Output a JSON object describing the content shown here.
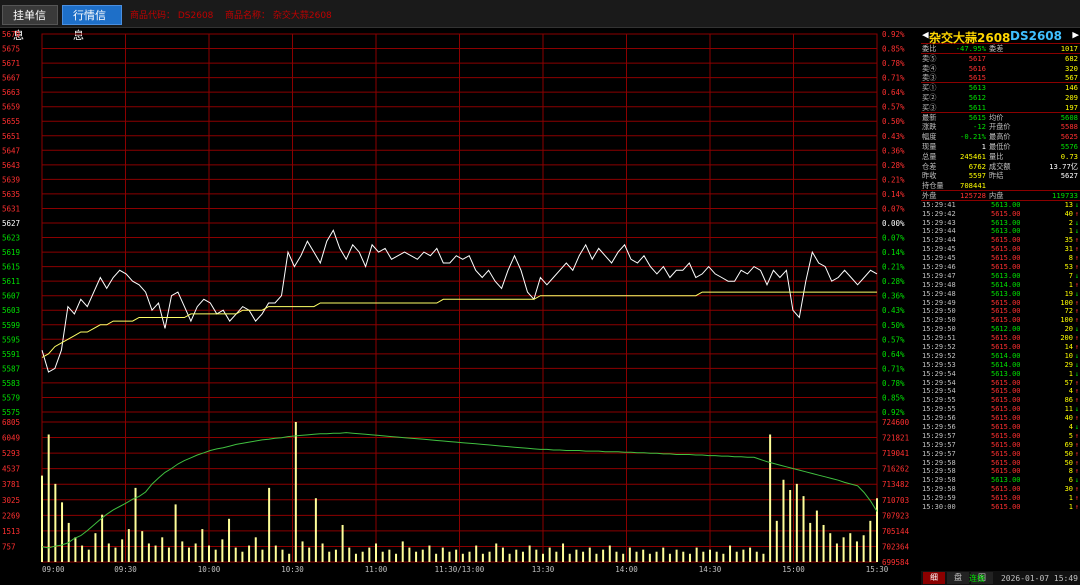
{
  "tabs": [
    {
      "label": "挂单信息",
      "active": false
    },
    {
      "label": "行情信息",
      "active": true
    }
  ],
  "top_info": {
    "code": "商品代码： DS2608",
    "name": "商品名称： 杂交大蒜2608"
  },
  "chart_data": [
    {
      "type": "line",
      "name": "price",
      "y_left_ticks": [
        "5679",
        "5675",
        "5671",
        "5667",
        "5663",
        "5659",
        "5655",
        "5651",
        "5647",
        "5643",
        "5639",
        "5635",
        "5631",
        "5627",
        "5623",
        "5619",
        "5615",
        "5611",
        "5607",
        "5603",
        "5599",
        "5595",
        "5591",
        "5587",
        "5583",
        "5579",
        "5575"
      ],
      "y_right_ticks": [
        "0.92%",
        "0.85%",
        "0.78%",
        "0.71%",
        "0.64%",
        "0.57%",
        "0.50%",
        "0.43%",
        "0.36%",
        "0.28%",
        "0.21%",
        "0.14%",
        "0.07%",
        "0.00%",
        "0.07%",
        "0.14%",
        "0.21%",
        "0.28%",
        "0.36%",
        "0.43%",
        "0.50%",
        "0.57%",
        "0.64%",
        "0.71%",
        "0.78%",
        "0.85%",
        "0.92%"
      ],
      "ylim": [
        5575,
        5679
      ],
      "reference": 5627,
      "x_ticks": [
        "09:00",
        "09:30",
        "10:00",
        "10:30",
        "11:00",
        "11:30/13:00",
        "13:30",
        "14:00",
        "14:30",
        "15:00",
        "15:30"
      ],
      "series": [
        {
          "color": "#ffffff",
          "values": [
            5592,
            5586,
            5587,
            5592,
            5604,
            5602,
            5606,
            5604,
            5608,
            5612,
            5609,
            5612,
            5614,
            5613,
            5611,
            5610,
            5608,
            5603,
            5605,
            5598,
            5607,
            5608,
            5604,
            5600,
            5604,
            5606,
            5605,
            5602,
            5603,
            5600,
            5602,
            5604,
            5603,
            5600,
            5602,
            5605,
            5605,
            5607,
            5619,
            5615,
            5618,
            5622,
            5619,
            5616,
            5622,
            5625,
            5620,
            5617,
            5621,
            5619,
            5615,
            5621,
            5619,
            5620,
            5617,
            5618,
            5619,
            5618,
            5617,
            5619,
            5618,
            5620,
            5616,
            5616,
            5618,
            5617,
            5618,
            5614,
            5612,
            5614,
            5611,
            5609,
            5614,
            5618,
            5614,
            5608,
            5606,
            5612,
            5610,
            5612,
            5614,
            5616,
            5614,
            5618,
            5621,
            5617,
            5620,
            5618,
            5616,
            5619,
            5621,
            5617,
            5616,
            5618,
            5615,
            5613,
            5615,
            5612,
            5614,
            5614,
            5616,
            5612,
            5613,
            5615,
            5613,
            5612,
            5611,
            5611,
            5614,
            5613,
            5615,
            5614,
            5610,
            5614,
            5612,
            5614,
            5603,
            5601,
            5611,
            5619,
            5616,
            5615,
            5611,
            5612,
            5614,
            5612,
            5610,
            5612,
            5614,
            5613
          ]
        },
        {
          "color": "#ffff66",
          "values": [
            5590,
            5591,
            5593,
            5594,
            5595,
            5596,
            5597,
            5597,
            5598,
            5599,
            5599,
            5600,
            5600,
            5600,
            5600,
            5601,
            5601,
            5601,
            5601,
            5601,
            5601,
            5601,
            5601,
            5602,
            5602,
            5602,
            5602,
            5602,
            5602,
            5602,
            5602,
            5603,
            5603,
            5603,
            5603,
            5604,
            5604,
            5604,
            5604,
            5604,
            5604,
            5604,
            5604,
            5605,
            5605,
            5605,
            5605,
            5605,
            5605,
            5605,
            5605,
            5605,
            5605,
            5605,
            5605,
            5605,
            5605,
            5605,
            5605,
            5605,
            5605,
            5605,
            5606,
            5606,
            5606,
            5606,
            5606,
            5606,
            5606,
            5606,
            5606,
            5606,
            5606,
            5606,
            5606,
            5606,
            5606,
            5607,
            5607,
            5607,
            5607,
            5607,
            5607,
            5607,
            5607,
            5607,
            5607,
            5607,
            5607,
            5607,
            5607,
            5607,
            5607,
            5607,
            5607,
            5607,
            5607,
            5607,
            5607,
            5607,
            5607,
            5607,
            5608,
            5608,
            5608,
            5608,
            5608,
            5608,
            5608,
            5608,
            5608,
            5608,
            5608,
            5608,
            5608,
            5608,
            5608,
            5608,
            5608,
            5608,
            5608,
            5608,
            5608,
            5608,
            5608,
            5608,
            5608,
            5608,
            5608,
            5608
          ]
        }
      ]
    },
    {
      "type": "bar",
      "name": "volume",
      "y_left_ticks": [
        "6805",
        "6049",
        "5293",
        "4537",
        "3781",
        "3025",
        "2269",
        "1513",
        "757"
      ],
      "y_right_ticks": [
        "724600",
        "721821",
        "719041",
        "716262",
        "713482",
        "710703",
        "707923",
        "705144",
        "702364",
        "699584"
      ],
      "ylim": [
        0,
        6805
      ],
      "oi_lim": [
        699584,
        724600
      ],
      "bars": [
        4200,
        6200,
        3800,
        2900,
        1900,
        1200,
        800,
        600,
        1400,
        2300,
        900,
        700,
        1100,
        1600,
        3600,
        1500,
        900,
        800,
        1200,
        700,
        2800,
        1000,
        700,
        900,
        1600,
        800,
        600,
        1100,
        2100,
        700,
        500,
        800,
        1200,
        600,
        3600,
        800,
        600,
        400,
        6900,
        1000,
        700,
        3100,
        900,
        500,
        600,
        1800,
        700,
        400,
        500,
        700,
        900,
        500,
        600,
        400,
        1000,
        700,
        500,
        600,
        800,
        400,
        700,
        500,
        600,
        400,
        500,
        800,
        400,
        500,
        900,
        700,
        400,
        600,
        500,
        800,
        600,
        400,
        700,
        500,
        900,
        400,
        600,
        500,
        700,
        400,
        600,
        800,
        500,
        400,
        700,
        500,
        600,
        400,
        500,
        700,
        400,
        600,
        500,
        400,
        700,
        500,
        600,
        500,
        400,
        800,
        500,
        600,
        700,
        500,
        400,
        6200,
        2000,
        4000,
        3500,
        3800,
        3200,
        1900,
        2500,
        1800,
        1400,
        900,
        1200,
        1400,
        1000,
        1300,
        2000,
        3100
      ],
      "oi": [
        702300,
        702100,
        702400,
        702600,
        703000,
        703800,
        704300,
        705200,
        706200,
        707200,
        708100,
        708900,
        709500,
        710100,
        710800,
        711300,
        712100,
        713500,
        714600,
        715600,
        716300,
        717100,
        717700,
        718200,
        718700,
        719100,
        719500,
        719800,
        720000,
        720300,
        720600,
        720800,
        721000,
        721200,
        721400,
        721500,
        721700,
        721800,
        722000,
        722100,
        722200,
        722300,
        722400,
        722500,
        722500,
        722600,
        722600,
        722700,
        722600,
        722500,
        722400,
        722300,
        722200,
        722100,
        722000,
        721900,
        721800,
        721700,
        721600,
        721500,
        721400,
        721300,
        721200,
        721100,
        721000,
        720900,
        720800,
        720700,
        720600,
        720500,
        720400,
        720300,
        720200,
        720100,
        720000,
        719900,
        719800,
        719700,
        719700,
        719600,
        719600,
        719500,
        719500,
        719500,
        719400,
        719400,
        719400,
        719300,
        719300,
        719300,
        719200,
        719200,
        719100,
        719100,
        719000,
        719000,
        718900,
        718900,
        718800,
        718800,
        718800,
        718700,
        718700,
        718600,
        718600,
        718500,
        718500,
        718400,
        718400,
        718300,
        718300,
        717900,
        717500,
        717200,
        716900,
        716600,
        716300,
        716000,
        715700,
        715400,
        715100,
        714800,
        714500,
        714200,
        713800,
        713500,
        713200,
        712000,
        710500,
        708600
      ]
    }
  ],
  "panel": {
    "title_name": "杂交大蒜2608",
    "title_code": "DS2608",
    "weibi": {
      "l": "委比",
      "v": "-47.95%",
      "l2": "委差",
      "v2": "1017"
    },
    "asks": [
      {
        "l": "卖⑤",
        "v": "5617",
        "q": "682"
      },
      {
        "l": "卖④",
        "v": "5616",
        "q": "320"
      },
      {
        "l": "卖③",
        "v": "5615",
        "q": "567"
      }
    ],
    "bids": [
      {
        "l": "买①",
        "v": "5613",
        "q": "146"
      },
      {
        "l": "买②",
        "v": "5612",
        "q": "209"
      },
      {
        "l": "买③",
        "v": "5611",
        "q": "197"
      }
    ],
    "stats": [
      {
        "l": "最新",
        "v": "5615",
        "l2": "均价",
        "v2": "5608"
      },
      {
        "l": "涨跌",
        "v": "-12",
        "l2": "开盘价",
        "v2": "5588"
      },
      {
        "l": "幅度",
        "v": "-0.21%",
        "l2": "最高价",
        "v2": "5625"
      },
      {
        "l": "现量",
        "v": "1",
        "l2": "最低价",
        "v2": "5576"
      },
      {
        "l": "总量",
        "v": "245461",
        "l2": "量比",
        "v2": "0.73"
      },
      {
        "l": "仓差",
        "v": "6762",
        "l2": "成交额",
        "v2": "13.77亿"
      },
      {
        "l": "昨收",
        "v": "5597",
        "l2": "昨结",
        "v2": "5627"
      },
      {
        "l": "持仓量",
        "v": "708441",
        "l2": "",
        "v2": ""
      }
    ],
    "outer": {
      "l": "外盘",
      "v": "125728",
      "l2": "内盘",
      "v2": "119733"
    },
    "ticks": [
      [
        "15:29:41",
        "5613.00",
        "13",
        "↓"
      ],
      [
        "15:29:42",
        "5615.00",
        "40",
        "↑"
      ],
      [
        "15:29:43",
        "5613.00",
        "2",
        "↓"
      ],
      [
        "15:29:44",
        "5613.00",
        "1",
        "↓"
      ],
      [
        "15:29:44",
        "5615.00",
        "35",
        "↑"
      ],
      [
        "15:29:45",
        "5615.00",
        "31",
        "↑"
      ],
      [
        "15:29:45",
        "5615.00",
        "8",
        "↑"
      ],
      [
        "15:29:46",
        "5615.00",
        "53",
        "↑"
      ],
      [
        "15:29:47",
        "5613.00",
        "7",
        "↓"
      ],
      [
        "15:29:48",
        "5614.00",
        "1",
        "↑"
      ],
      [
        "15:29:48",
        "5613.00",
        "19",
        "↓"
      ],
      [
        "15:29:49",
        "5615.00",
        "100",
        "↑"
      ],
      [
        "15:29:50",
        "5615.00",
        "72",
        "↑"
      ],
      [
        "15:29:50",
        "5615.00",
        "100",
        "↑"
      ],
      [
        "15:29:50",
        "5612.00",
        "20",
        "↓"
      ],
      [
        "15:29:51",
        "5615.00",
        "200",
        "↑"
      ],
      [
        "15:29:52",
        "5615.00",
        "14",
        "↑"
      ],
      [
        "15:29:52",
        "5614.00",
        "10",
        "↓"
      ],
      [
        "15:29:53",
        "5614.00",
        "29",
        "↓"
      ],
      [
        "15:29:54",
        "5613.00",
        "1",
        "↓"
      ],
      [
        "15:29:54",
        "5615.00",
        "57",
        "↑"
      ],
      [
        "15:29:54",
        "5615.00",
        "4",
        "↑"
      ],
      [
        "15:29:55",
        "5615.00",
        "86",
        "↑"
      ],
      [
        "15:29:55",
        "5615.00",
        "11",
        "↓"
      ],
      [
        "15:29:56",
        "5615.00",
        "40",
        "↑"
      ],
      [
        "15:29:56",
        "5615.00",
        "4",
        "↓"
      ],
      [
        "15:29:57",
        "5615.00",
        "5",
        "↑"
      ],
      [
        "15:29:57",
        "5615.00",
        "69",
        "↑"
      ],
      [
        "15:29:57",
        "5615.00",
        "50",
        "↑"
      ],
      [
        "15:29:58",
        "5615.00",
        "50",
        "↑"
      ],
      [
        "15:29:58",
        "5615.00",
        "8",
        "↑"
      ],
      [
        "15:29:58",
        "5613.00",
        "6",
        "↓"
      ],
      [
        "15:29:58",
        "5615.00",
        "30",
        "↑"
      ],
      [
        "15:29:59",
        "5615.00",
        "1",
        "↑"
      ],
      [
        "15:30:00",
        "5615.00",
        "1",
        "↑"
      ]
    ],
    "bottom_tabs": [
      "细",
      "盘",
      "图"
    ]
  },
  "status": {
    "conn": "连接",
    "time": "2026-01-07 15:49"
  },
  "colors": {
    "grid": "#8b0000",
    "up": "#ff3030",
    "down": "#00e000",
    "price": "#ffffff",
    "avg": "#ffff66",
    "volume": "#ffff99",
    "oi": "#40c040"
  }
}
